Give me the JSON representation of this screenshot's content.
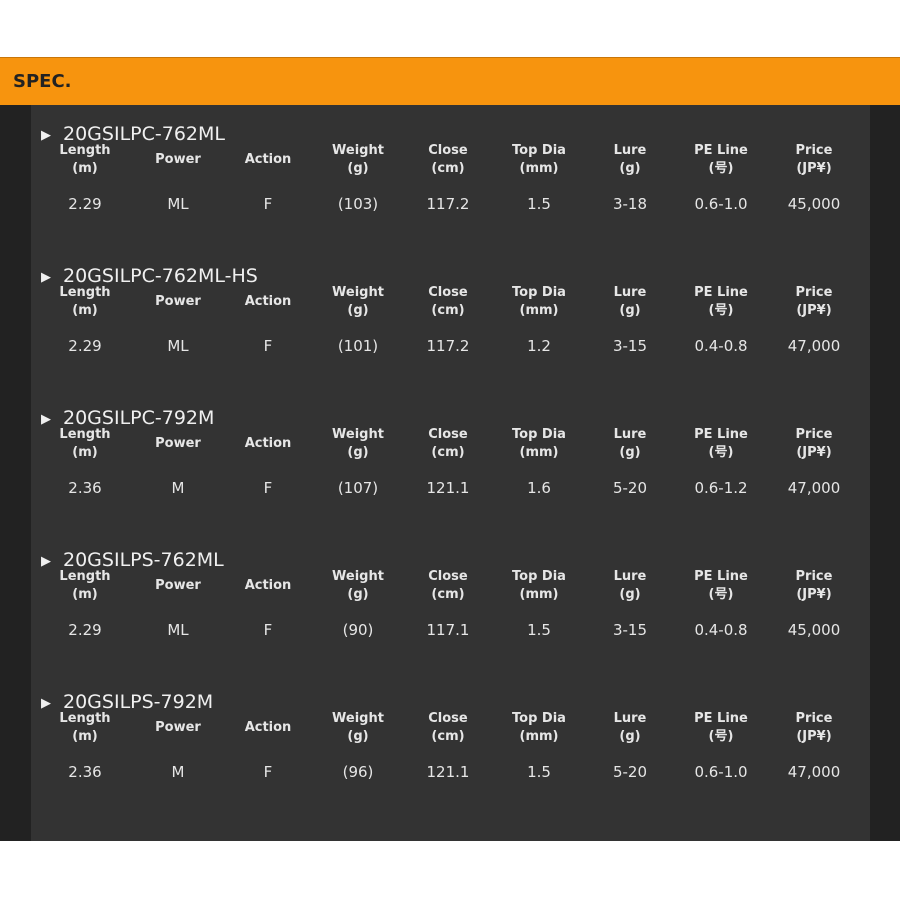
{
  "header": {
    "title": "SPEC."
  },
  "columns": [
    {
      "key": "length",
      "line1": "Length",
      "line2": "(m)"
    },
    {
      "key": "power",
      "line1": "Power",
      "line2": ""
    },
    {
      "key": "action",
      "line1": "Action",
      "line2": ""
    },
    {
      "key": "weight",
      "line1": "Weight",
      "line2": "(g)"
    },
    {
      "key": "close",
      "line1": "Close",
      "line2": "(cm)"
    },
    {
      "key": "topdia",
      "line1": "Top Dia",
      "line2": "(mm)"
    },
    {
      "key": "lure",
      "line1": "Lure",
      "line2": "(g)"
    },
    {
      "key": "peline",
      "line1": "PE Line",
      "line2": "(号)"
    },
    {
      "key": "price",
      "line1": "Price",
      "line2": "(JP¥)"
    }
  ],
  "models": [
    {
      "name": "20GSILPC-762ML",
      "values": [
        "2.29",
        "ML",
        "F",
        "(103)",
        "117.2",
        "1.5",
        "3-18",
        "0.6-1.0",
        "45,000"
      ]
    },
    {
      "name": "20GSILPC-762ML-HS",
      "values": [
        "2.29",
        "ML",
        "F",
        "(101)",
        "117.2",
        "1.2",
        "3-15",
        "0.4-0.8",
        "47,000"
      ]
    },
    {
      "name": "20GSILPC-792M",
      "values": [
        "2.36",
        "M",
        "F",
        "(107)",
        "121.1",
        "1.6",
        "5-20",
        "0.6-1.2",
        "47,000"
      ]
    },
    {
      "name": "20GSILPS-762ML",
      "values": [
        "2.29",
        "ML",
        "F",
        "(90)",
        "117.1",
        "1.5",
        "3-15",
        "0.4-0.8",
        "45,000"
      ]
    },
    {
      "name": "20GSILPS-792M",
      "values": [
        "2.36",
        "M",
        "F",
        "(96)",
        "121.1",
        "1.5",
        "5-20",
        "0.6-1.0",
        "47,000"
      ]
    }
  ],
  "icons": {
    "model_arrow": "triangle-right-icon"
  },
  "colors": {
    "header_bg": "#f7940e",
    "panel_bg": "#333333",
    "frame_bg": "#222222",
    "text": "#e6e6e6"
  }
}
